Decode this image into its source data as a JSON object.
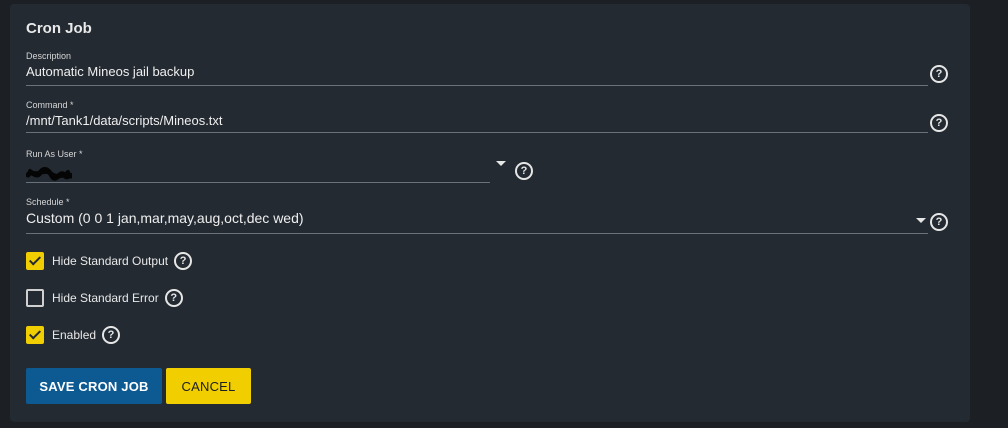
{
  "form": {
    "title": "Cron Job",
    "description": {
      "label": "Description",
      "value": "Automatic Mineos jail backup"
    },
    "command": {
      "label": "Command *",
      "value": "/mnt/Tank1/data/scripts/Mineos.txt"
    },
    "run_as_user": {
      "label": "Run As User *",
      "value": ""
    },
    "schedule": {
      "label": "Schedule *",
      "value": "Custom (0 0 1 jan,mar,may,aug,oct,dec wed)"
    },
    "checkboxes": [
      {
        "label": "Hide Standard Output",
        "checked": true
      },
      {
        "label": "Hide Standard Error",
        "checked": false
      },
      {
        "label": "Enabled",
        "checked": true
      }
    ],
    "help_glyph": "?",
    "buttons": {
      "save": "SAVE CRON JOB",
      "cancel": "CANCEL"
    }
  },
  "colors": {
    "accent_yellow": "#f0ce00",
    "primary_blue": "#0d5a93",
    "card_bg": "#232a32",
    "page_bg": "#1c1f24"
  },
  "icons": {
    "help": "question-circle-icon",
    "dropdown": "caret-down-icon",
    "check": "checkmark-icon"
  }
}
